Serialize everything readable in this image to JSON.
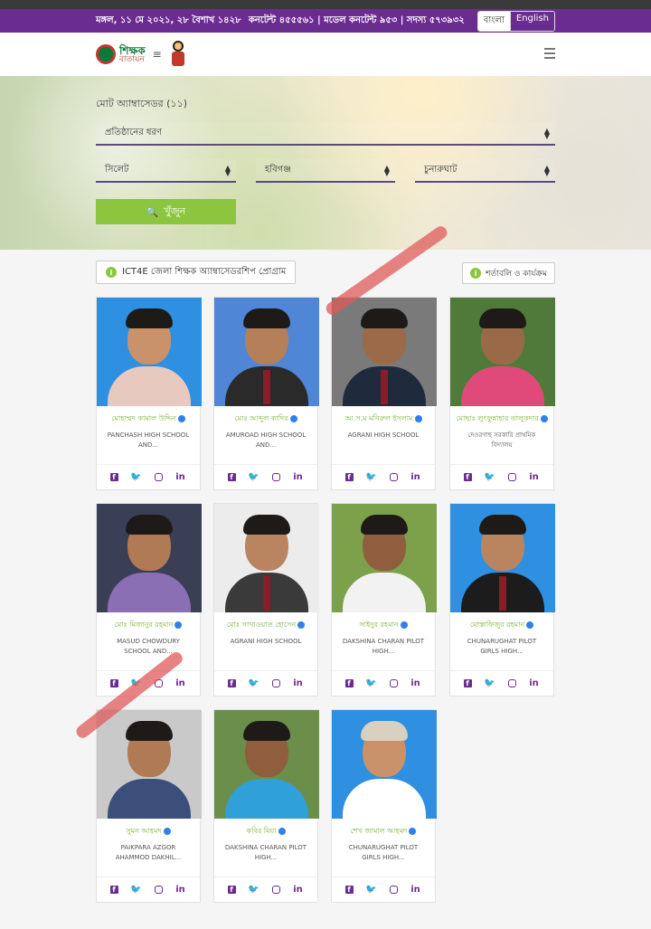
{
  "topbar": {
    "date": "মঙ্গল, ১১ মে ২০২১, ২৮ বৈশাখ ১৪২৮",
    "stats": "কনটেন্ট ৪৫৫৫৬১ | মডেল কনটেন্ট ৯৫৩ | সদস্য ৫৭৩৯৩২",
    "lang_bn": "বাংলা",
    "lang_en": "English"
  },
  "header": {
    "logo_title": "শিক্ষক",
    "logo_subtitle": "বাতায়ন",
    "logo_lines": "≡"
  },
  "hero": {
    "title": "মোট অ্যাম্বাসেডর (১১)",
    "filter_institution": "প্রতিষ্ঠানের ধরণ",
    "filter_division": "সিলেট",
    "filter_district": "হবিগঞ্জ",
    "filter_upazila": "চুনারুঘাট",
    "search_label": "খুঁজুন",
    "search_icon": "🔍"
  },
  "program": {
    "title": "ICT4E জেলা শিক্ষক অ্যাম্বাসেডরশিপ প্রোগ্রাম",
    "rules_label": "শর্তাবলি ও কার্যক্রম",
    "info_icon": "i"
  },
  "social": {
    "fb": "f",
    "tw": "🐦",
    "ig": "◎",
    "in": "in"
  },
  "teachers": [
    {
      "name": "মোহাম্মদ কামাল উদ্দিন",
      "school": "PANCHASH HIGH SCHOOL AND...",
      "bg": "#2f8fe0",
      "skin": "#c9926a",
      "shirt": "#e8c9c0",
      "hair": "#1e1a18"
    },
    {
      "name": "মোঃ আব্দুল কাদির",
      "school": "AMUROAD HIGH SCHOOL AND...",
      "bg": "#4f86d6",
      "skin": "#b57f5a",
      "shirt": "#2a2a2a",
      "hair": "#1e1a18"
    },
    {
      "name": "আ.স.ম মনিরুল ইসলাম",
      "school": "AGRANI HIGH SCHOOL",
      "bg": "#7a7a7a",
      "skin": "#9b6a49",
      "shirt": "#1f2b3d",
      "hair": "#1e1a18"
    },
    {
      "name": "মোছাঃ লুৎফুন্নাহার তালুকদার",
      "school": "দেওরগাছ সরকারি প্রাথমিক বিদ্যালয়",
      "bg": "#4f7a3a",
      "skin": "#9a6a48",
      "shirt": "#e04a7a",
      "hair": "#1e1a18"
    },
    {
      "name": "মোঃ মিজানুর রহমান",
      "school": "MASUD CHOWDURY SCHOOL AND...",
      "bg": "#3b3f55",
      "skin": "#b07a55",
      "shirt": "#8a6fb5",
      "hair": "#1e1a18"
    },
    {
      "name": "মোঃ সাখাওয়াত হোসেন",
      "school": "AGRANI HIGH SCHOOL",
      "bg": "#ececec",
      "skin": "#b98560",
      "shirt": "#3a3a3a",
      "hair": "#1e1a18"
    },
    {
      "name": "সাইদুর রহমান",
      "school": "DAKSHINA CHARAN PILOT HIGH...",
      "bg": "#7da04a",
      "skin": "#8f5e3e",
      "shirt": "#f2f2f2",
      "hair": "#1e1a18"
    },
    {
      "name": "মোস্তাফিজুর রহমান",
      "school": "CHUNARUGHAT PILOT GIRLS HIGH...",
      "bg": "#2f8fe0",
      "skin": "#b98560",
      "shirt": "#1c1c1c",
      "hair": "#1e1a18"
    },
    {
      "name": "সুমন আহমদ",
      "school": "PAIKPARA AZGOR AHAMMOD DAKHIL...",
      "bg": "#c9c9c9",
      "skin": "#b07a55",
      "shirt": "#3b4f7a",
      "hair": "#1e1a18"
    },
    {
      "name": "কবির মিয়া",
      "school": "DAKSHINA CHARAN PILOT HIGH...",
      "bg": "#6b8f4a",
      "skin": "#8f5e3e",
      "shirt": "#2fa0d8",
      "hair": "#1e1a18"
    },
    {
      "name": "শেখ জামাল আহমদ",
      "school": "CHUNARUGHAT PILOT GIRLS HIGH...",
      "bg": "#2f8fe0",
      "skin": "#c9926a",
      "shirt": "#ffffff",
      "hair": "#d8d0c0"
    }
  ]
}
